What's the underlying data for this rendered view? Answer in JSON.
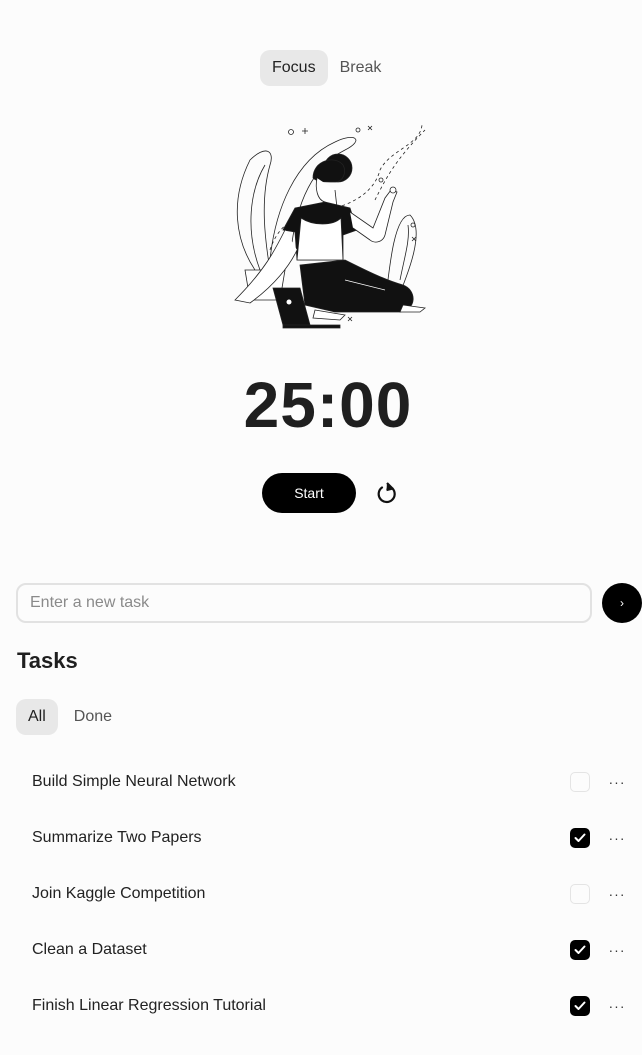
{
  "mode_toggle": {
    "options": [
      {
        "label": "Focus",
        "active": true
      },
      {
        "label": "Break",
        "active": false
      }
    ]
  },
  "illustration": {
    "icon": "meditating-person-illustration"
  },
  "timer": {
    "display": "25:00"
  },
  "controls": {
    "start_label": "Start",
    "reset_icon": "reset-icon"
  },
  "task_input": {
    "value": "",
    "placeholder": "Enter a new task",
    "submit_icon": "chevron-right-icon",
    "submit_glyph": "›"
  },
  "tasks_section": {
    "heading": "Tasks",
    "filters": [
      {
        "label": "All",
        "active": true
      },
      {
        "label": "Done",
        "active": false
      }
    ],
    "items": [
      {
        "title": "Build Simple Neural Network",
        "done": false
      },
      {
        "title": "Summarize Two Papers",
        "done": true
      },
      {
        "title": "Join Kaggle Competition",
        "done": false
      },
      {
        "title": "Clean a Dataset",
        "done": true
      },
      {
        "title": "Finish Linear Regression Tutorial",
        "done": true
      }
    ],
    "more_glyph": "···"
  }
}
